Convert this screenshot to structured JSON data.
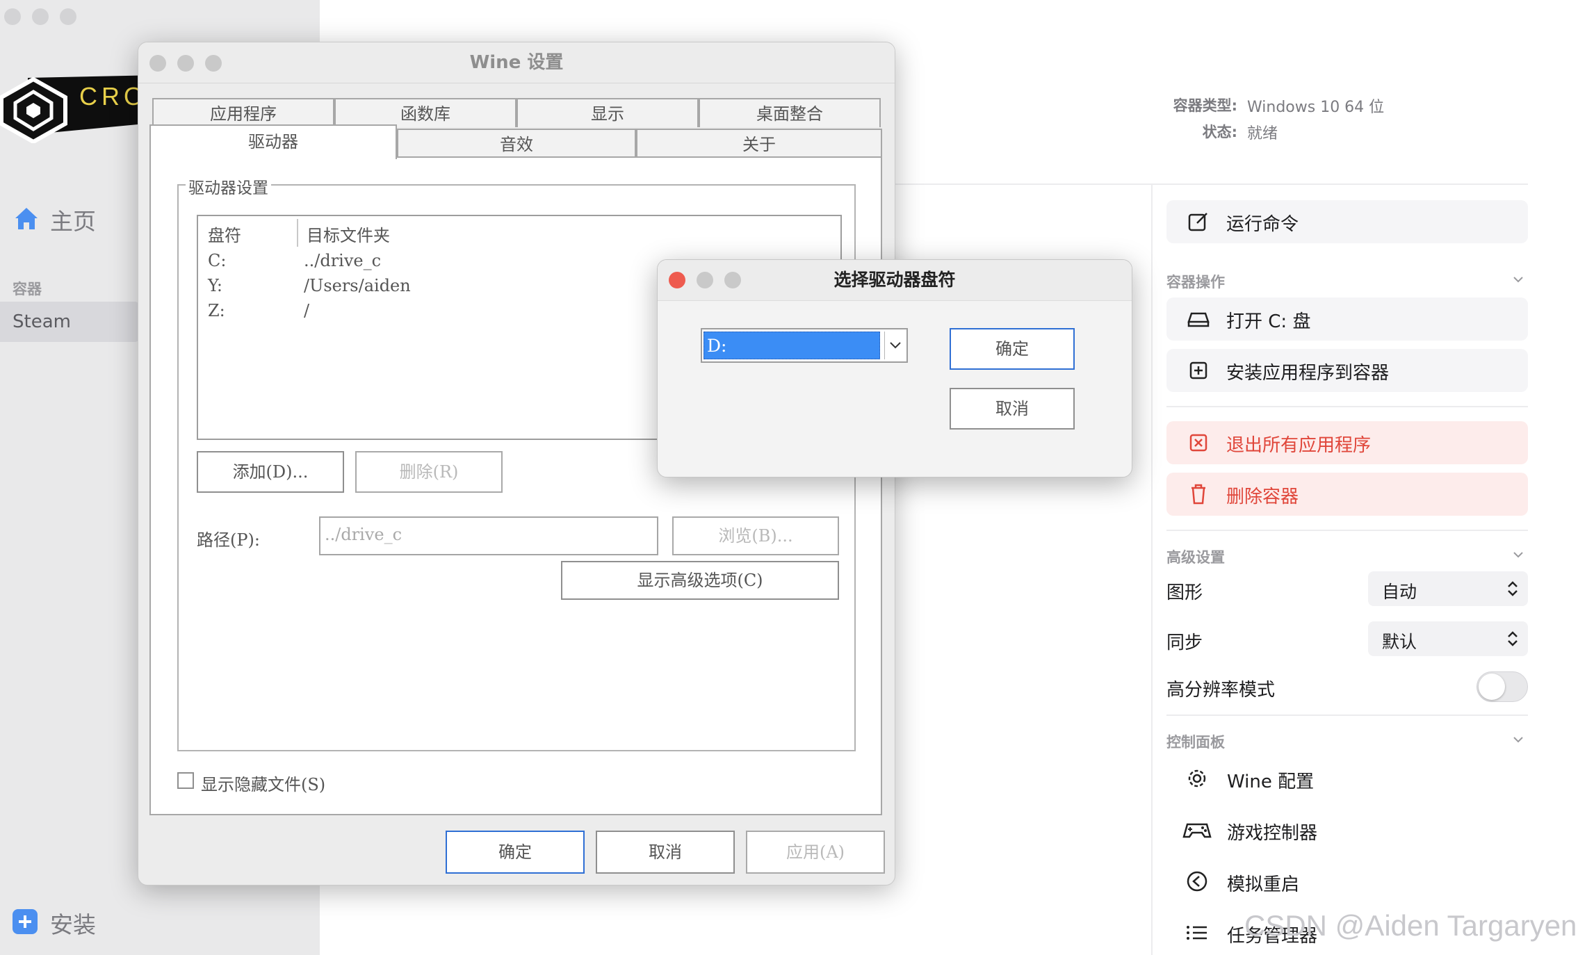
{
  "sidebar": {
    "logo_text": "CRO",
    "home_label": "主页",
    "section_label": "容器",
    "steam_label": "Steam",
    "install_label": "安装"
  },
  "container_info": {
    "type_key": "容器类型:",
    "type_value": "Windows 10 64 位",
    "status_key": "状态:",
    "status_value": "就绪"
  },
  "actions": {
    "run_command": "运行命令",
    "group_container_ops": "容器操作",
    "open_c_drive": "打开 C: 盘",
    "install_app": "安装应用程序到容器",
    "quit_all": "退出所有应用程序",
    "delete_container": "删除容器"
  },
  "advanced": {
    "group_label": "高级设置",
    "graphics_label": "图形",
    "graphics_value": "自动",
    "sync_label": "同步",
    "sync_value": "默认",
    "hidpi_label": "高分辨率模式",
    "hidpi_on": false
  },
  "control_panel": {
    "group_label": "控制面板",
    "items": [
      "Wine 配置",
      "游戏控制器",
      "模拟重启",
      "任务管理器"
    ]
  },
  "wine_window": {
    "title": "Wine 设置",
    "tabs_row1": [
      "应用程序",
      "函数库",
      "显示",
      "桌面整合"
    ],
    "tabs_row2": [
      "驱动器",
      "音效",
      "关于"
    ],
    "selected_tab": "驱动器",
    "group_title": "驱动器设置",
    "col_letter": "盘符",
    "col_target": "目标文件夹",
    "drives": [
      {
        "letter": "C:",
        "target": "../drive_c"
      },
      {
        "letter": "Y:",
        "target": "/Users/aiden"
      },
      {
        "letter": "Z:",
        "target": "/"
      }
    ],
    "add_btn": "添加(D)...",
    "remove_btn": "删除(R)",
    "path_label": "路径(P):",
    "path_value": "../drive_c",
    "browse_btn": "浏览(B)...",
    "advanced_btn": "显示高级选项(C)",
    "show_hidden": "显示隐藏文件(S)",
    "ok_btn": "确定",
    "cancel_btn": "取消",
    "apply_btn": "应用(A)"
  },
  "drive_dialog": {
    "title": "选择驱动器盘符",
    "selected_value": "D:",
    "ok_btn": "确定",
    "cancel_btn": "取消"
  },
  "watermark": "CSDN @Aiden Targaryen",
  "colors": {
    "accent_blue": "#2f6fd4",
    "selection_blue": "#3b8df5",
    "danger_red": "#e0463a",
    "close_red": "#ee5b4f"
  }
}
